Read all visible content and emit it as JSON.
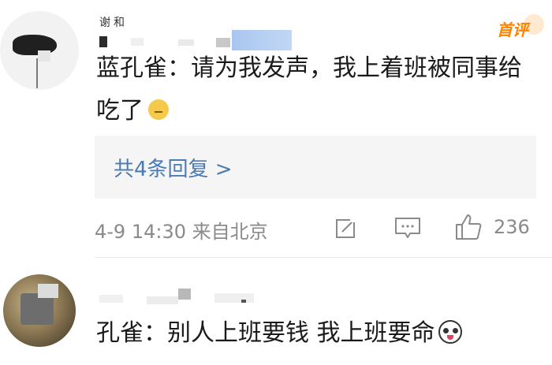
{
  "comments": [
    {
      "username_partial": "谢和",
      "badge": "首评",
      "text": "蓝孔雀：请为我发声，我上着班被同事给吃了",
      "reply_link": "共4条回复 >",
      "time_location": "4-9 14:30 来自北京",
      "like_count": "236"
    },
    {
      "text": "孔雀：别人上班要钱 我上班要命"
    }
  ],
  "icons": {
    "share": "share-icon",
    "comment": "comment-icon",
    "like": "thumbs-up-icon",
    "emoji1": "sweat-smile-emoji-icon",
    "emoji2": "panda-emoji-icon"
  },
  "colors": {
    "badge": "#ff8200",
    "link": "#4c7ab3",
    "meta": "#8a8a8a",
    "text": "#1a1a1a"
  }
}
